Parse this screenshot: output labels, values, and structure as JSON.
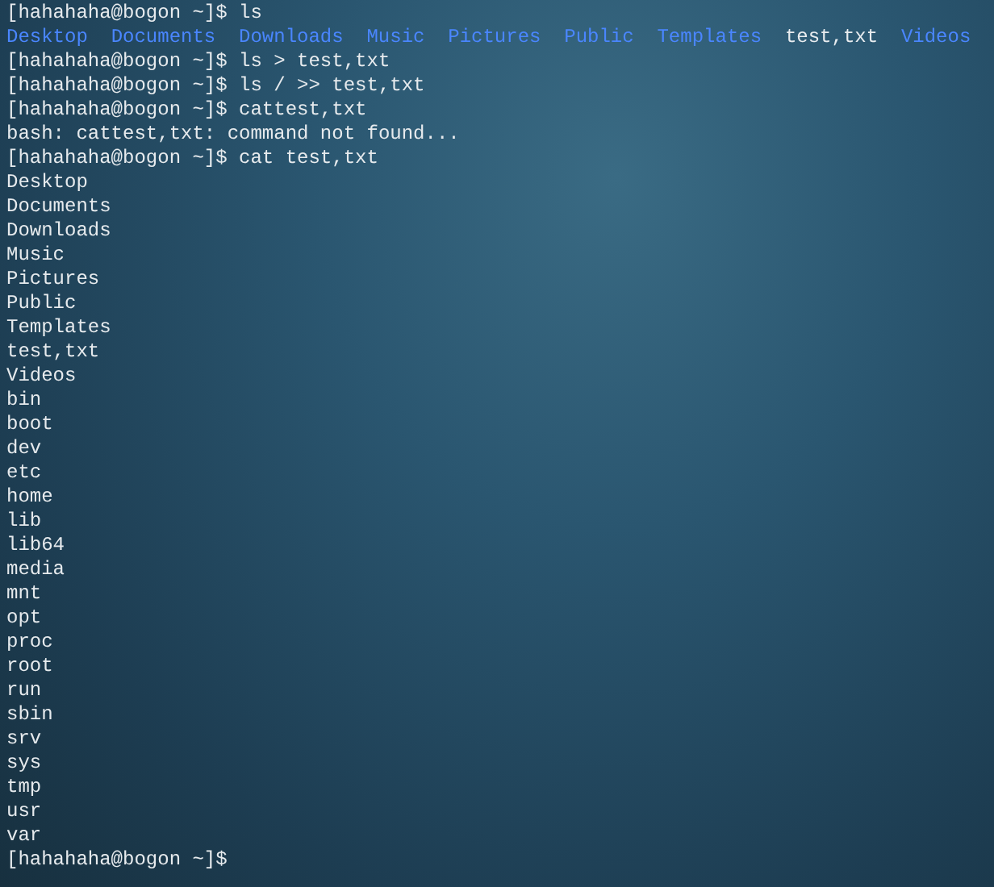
{
  "lines": [
    {
      "kind": "prompt",
      "prompt": "[hahahaha@bogon ~]$",
      "command": "ls"
    },
    {
      "kind": "listing",
      "items": [
        {
          "name": "Desktop",
          "kind": "dir"
        },
        {
          "name": "Documents",
          "kind": "dir"
        },
        {
          "name": "Downloads",
          "kind": "dir"
        },
        {
          "name": "Music",
          "kind": "dir"
        },
        {
          "name": "Pictures",
          "kind": "dir"
        },
        {
          "name": "Public",
          "kind": "dir"
        },
        {
          "name": "Templates",
          "kind": "dir"
        },
        {
          "name": "test,txt",
          "kind": "file"
        },
        {
          "name": "Videos",
          "kind": "dir"
        }
      ]
    },
    {
      "kind": "prompt",
      "prompt": "[hahahaha@bogon ~]$",
      "command": "ls > test,txt"
    },
    {
      "kind": "prompt",
      "prompt": "[hahahaha@bogon ~]$",
      "command": "ls / >> test,txt"
    },
    {
      "kind": "prompt",
      "prompt": "[hahahaha@bogon ~]$",
      "command": "cattest,txt"
    },
    {
      "kind": "output",
      "text": "bash: cattest,txt: command not found..."
    },
    {
      "kind": "prompt",
      "prompt": "[hahahaha@bogon ~]$",
      "command": "cat test,txt"
    },
    {
      "kind": "output",
      "text": "Desktop"
    },
    {
      "kind": "output",
      "text": "Documents"
    },
    {
      "kind": "output",
      "text": "Downloads"
    },
    {
      "kind": "output",
      "text": "Music"
    },
    {
      "kind": "output",
      "text": "Pictures"
    },
    {
      "kind": "output",
      "text": "Public"
    },
    {
      "kind": "output",
      "text": "Templates"
    },
    {
      "kind": "output",
      "text": "test,txt"
    },
    {
      "kind": "output",
      "text": "Videos"
    },
    {
      "kind": "output",
      "text": "bin"
    },
    {
      "kind": "output",
      "text": "boot"
    },
    {
      "kind": "output",
      "text": "dev"
    },
    {
      "kind": "output",
      "text": "etc"
    },
    {
      "kind": "output",
      "text": "home"
    },
    {
      "kind": "output",
      "text": "lib"
    },
    {
      "kind": "output",
      "text": "lib64"
    },
    {
      "kind": "output",
      "text": "media"
    },
    {
      "kind": "output",
      "text": "mnt"
    },
    {
      "kind": "output",
      "text": "opt"
    },
    {
      "kind": "output",
      "text": "proc"
    },
    {
      "kind": "output",
      "text": "root"
    },
    {
      "kind": "output",
      "text": "run"
    },
    {
      "kind": "output",
      "text": "sbin"
    },
    {
      "kind": "output",
      "text": "srv"
    },
    {
      "kind": "output",
      "text": "sys"
    },
    {
      "kind": "output",
      "text": "tmp"
    },
    {
      "kind": "output",
      "text": "usr"
    },
    {
      "kind": "output",
      "text": "var"
    },
    {
      "kind": "prompt",
      "prompt": "[hahahaha@bogon ~]$"
    }
  ]
}
